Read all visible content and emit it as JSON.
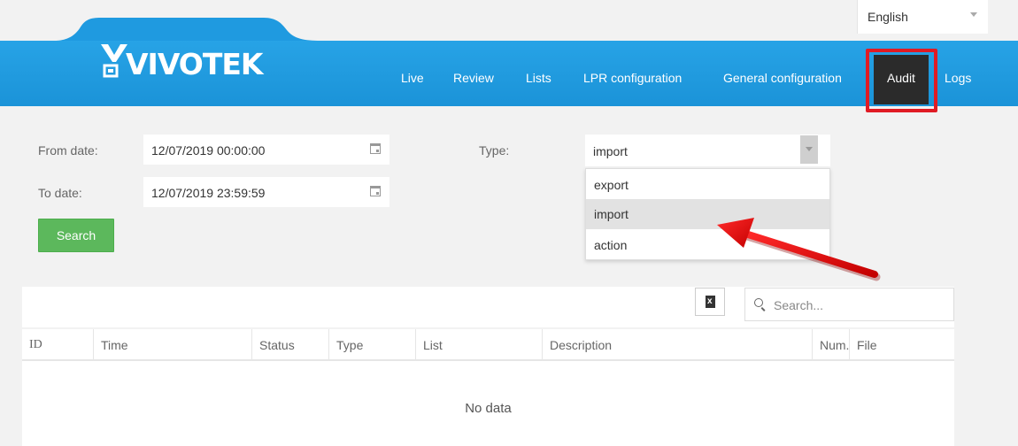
{
  "brand": {
    "name": "VIVOTEK"
  },
  "language": {
    "selected": "English"
  },
  "nav": {
    "items": [
      {
        "label": "Live"
      },
      {
        "label": "Review"
      },
      {
        "label": "Lists"
      },
      {
        "label": "LPR configuration"
      },
      {
        "label": "General configuration"
      },
      {
        "label": "Audit",
        "active": true
      },
      {
        "label": "Logs"
      }
    ]
  },
  "filters": {
    "from_label": "From date:",
    "from_value": "12/07/2019 00:00:00",
    "to_label": "To date:",
    "to_value": "12/07/2019 23:59:59",
    "type_label": "Type:",
    "type_value": "import",
    "type_options": [
      "export",
      "import",
      "action"
    ],
    "search_button": "Search"
  },
  "table": {
    "search_placeholder": "Search...",
    "export_icon": "excel-export-icon",
    "columns": [
      "ID",
      "Time",
      "Status",
      "Type",
      "List",
      "Description",
      "Num.",
      "File"
    ],
    "empty_text": "No data"
  },
  "colors": {
    "nav_blue": "#1f9ae0",
    "active_tab": "#2b2b2b",
    "highlight_red": "#e01b24",
    "search_green": "#5cb85c"
  }
}
